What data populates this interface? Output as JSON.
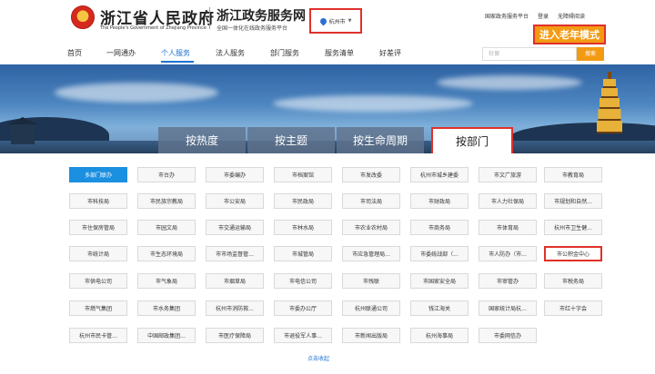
{
  "header": {
    "gov_title": "浙江省人民政府",
    "gov_subtitle": "The People's Government of Zhejiang Province",
    "service_title": "浙江政务服务网",
    "service_subtitle": "全国一体化在线政务服务平台",
    "city": "杭州市",
    "top_links": [
      "国家政务服务平台",
      "登录",
      "无障碍阅读"
    ],
    "elder_mode": "进入老年模式"
  },
  "nav": {
    "items": [
      "首页",
      "一网通办",
      "个人服务",
      "法人服务",
      "部门服务",
      "服务清单",
      "好差评"
    ],
    "active_index": 2,
    "search_placeholder": "社保",
    "search_button": "搜索"
  },
  "tabs": {
    "items": [
      "按热度",
      "按主题",
      "按生命周期",
      "按部门"
    ],
    "active_index": 3
  },
  "departments": [
    [
      "多部门联办",
      "市台办",
      "市委编办",
      "市档案馆",
      "市发改委",
      "杭州市城乡建委",
      "市文广旅游",
      "市教育局"
    ],
    [
      "市科技局",
      "市民族宗教局",
      "市公安局",
      "市民政局",
      "市司法局",
      "市财政局",
      "市人力社保局",
      "市规划和自然..."
    ],
    [
      "市住保房管局",
      "市园文局",
      "市交通运输局",
      "市林水局",
      "市农业农村局",
      "市商务局",
      "市体育局",
      "杭州市卫生健..."
    ],
    [
      "市统计局",
      "市生态环境局",
      "市市场监督管...",
      "市城管局",
      "市应急管理局...",
      "市委统战部（...",
      "市人防办（市...",
      "市公积金中心"
    ],
    [
      "市供电公司",
      "市气象局",
      "市烟草局",
      "市电信公司",
      "市残联",
      "市国家安全局",
      "市审管办",
      "市税务局"
    ],
    [
      "市燃气集团",
      "市水务集团",
      "杭州市消防救...",
      "市委办公厅",
      "杭州联通公司",
      "钱江海关",
      "国家统计局杭...",
      "市红十字会"
    ],
    [
      "杭州市民卡管...",
      "中国邮政集团...",
      "市医疗保障局",
      "市退役军人事...",
      "市新闻出版局",
      "杭州海事局",
      "市委网信办"
    ]
  ],
  "selected_department": "多部门联办",
  "highlighted_department": "市公积金中心",
  "more_label": "点击收起",
  "colors": {
    "accent": "#1b8fe0",
    "orange": "#f39a13",
    "highlight_red": "#e0302a"
  }
}
